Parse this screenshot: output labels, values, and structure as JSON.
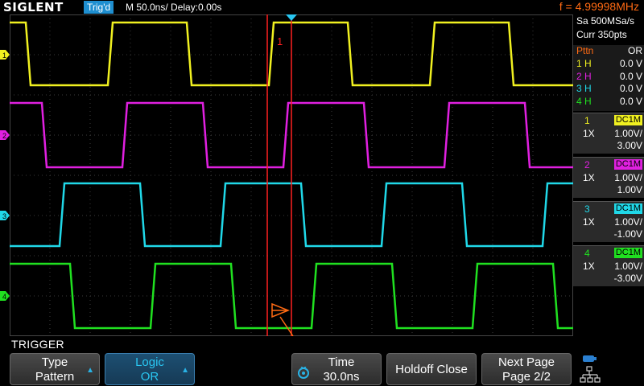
{
  "header": {
    "logo": "SIGLENT",
    "trigger_status": "Trig'd",
    "timebase": "M 50.0ns/",
    "delay": "Delay:0.00s",
    "frequency": "f = 4.99998MHz"
  },
  "acquisition": {
    "sample_rate": "Sa 500MSa/s",
    "memory_depth": "Curr 350pts"
  },
  "pattern_table": {
    "header_left": "Pttn",
    "header_right": "OR",
    "rows": [
      {
        "label": "1 H",
        "value": "0.0 V",
        "color": "#f0f020"
      },
      {
        "label": "2 H",
        "value": "0.0 V",
        "color": "#e020e0"
      },
      {
        "label": "3 H",
        "value": "0.0 V",
        "color": "#20d8e8"
      },
      {
        "label": "4 H",
        "value": "0.0 V",
        "color": "#20e020"
      }
    ]
  },
  "channels": [
    {
      "num": "1",
      "coupling": "DC1M",
      "probe": "1X",
      "scale": "1.00V/",
      "offset": "3.00V",
      "color": "#f0f020"
    },
    {
      "num": "2",
      "coupling": "DC1M",
      "probe": "1X",
      "scale": "1.00V/",
      "offset": "1.00V",
      "color": "#e020e0"
    },
    {
      "num": "3",
      "coupling": "DC1M",
      "probe": "1X",
      "scale": "1.00V/",
      "offset": "-1.00V",
      "color": "#20d8e8"
    },
    {
      "num": "4",
      "coupling": "DC1M",
      "probe": "1X",
      "scale": "1.00V/",
      "offset": "-3.00V",
      "color": "#20e020"
    }
  ],
  "markers": {
    "cursor_label": "1",
    "left_markers": [
      "1",
      "2",
      "3",
      "4"
    ]
  },
  "menu": {
    "title": "TRIGGER",
    "softkeys": [
      {
        "line1": "Type",
        "line2": "Pattern"
      },
      {
        "line1": "Logic",
        "line2": "OR"
      },
      {
        "line1": "Time",
        "line2": "30.0ns"
      },
      {
        "line1": "Holdoff Close",
        "line2": ""
      },
      {
        "line1": "Next Page",
        "line2": "Page 2/2"
      }
    ]
  },
  "icons": {
    "trigger_position": "trigger-position-icon",
    "cursor_arrow": "cursor-arrow-icon",
    "adjust_knob": "adjust-knob-icon",
    "network": "network-icon",
    "softkey_arrow": "softkey-arrow-icon"
  },
  "colors": {
    "ch1": "#f0f020",
    "ch2": "#e020e0",
    "ch3": "#20d8e8",
    "ch4": "#20e020",
    "cursor": "#ff2020",
    "accent": "#ff6a13",
    "badge": "#1f8fd0"
  }
}
